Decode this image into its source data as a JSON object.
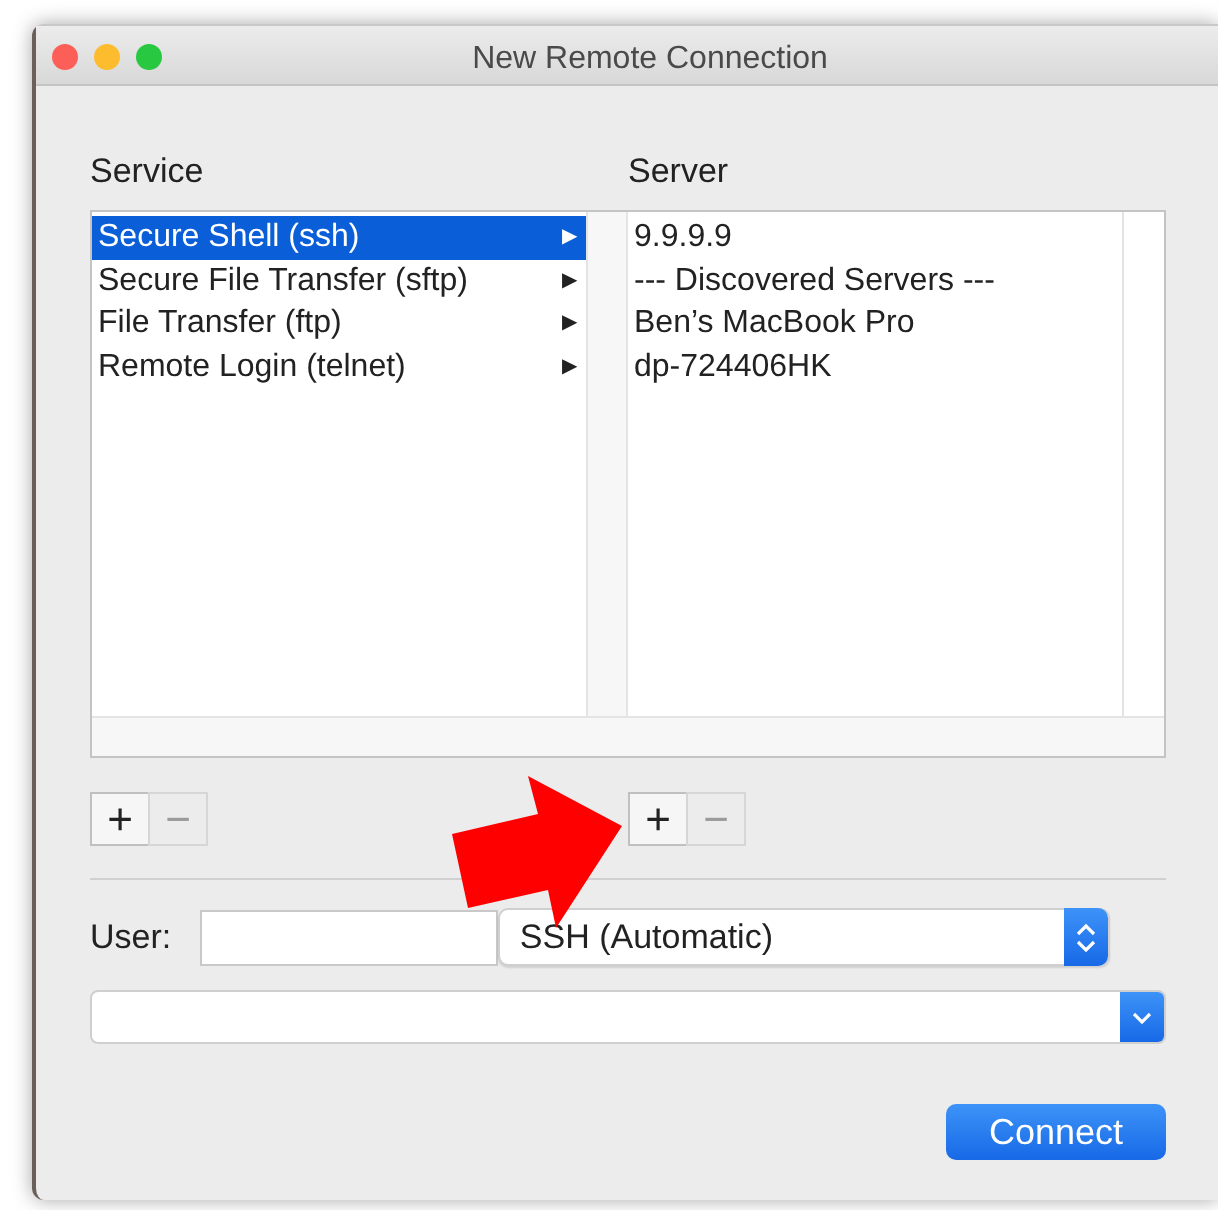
{
  "window": {
    "title": "New Remote Connection"
  },
  "service": {
    "label": "Service",
    "items": [
      {
        "name": "Secure Shell (ssh)",
        "arrow": "▶",
        "selected": true
      },
      {
        "name": "Secure File Transfer (sftp)",
        "arrow": "▶",
        "selected": false
      },
      {
        "name": "File Transfer (ftp)",
        "arrow": "▶",
        "selected": false
      },
      {
        "name": "Remote Login (telnet)",
        "arrow": "▶",
        "selected": false
      }
    ],
    "buttons": [
      {
        "label": "+",
        "disabled": false
      },
      {
        "label": "−",
        "disabled": true
      }
    ]
  },
  "server": {
    "label": "Server",
    "items": [
      {
        "name": "9.9.9.9",
        "selected": false
      },
      {
        "name": "--- Discovered Servers ---",
        "selected": false
      },
      {
        "name": "Ben’s MacBook Pro",
        "selected": false
      },
      {
        "name": "dp-724406HK",
        "selected": false
      }
    ],
    "buttons": [
      {
        "label": "+",
        "disabled": false
      },
      {
        "label": "−",
        "disabled": true
      }
    ]
  },
  "user": {
    "label": "User:"
  },
  "protocol_popup": {
    "value": "SSH (Automatic)"
  },
  "connect_button": {
    "label": "Connect"
  }
}
